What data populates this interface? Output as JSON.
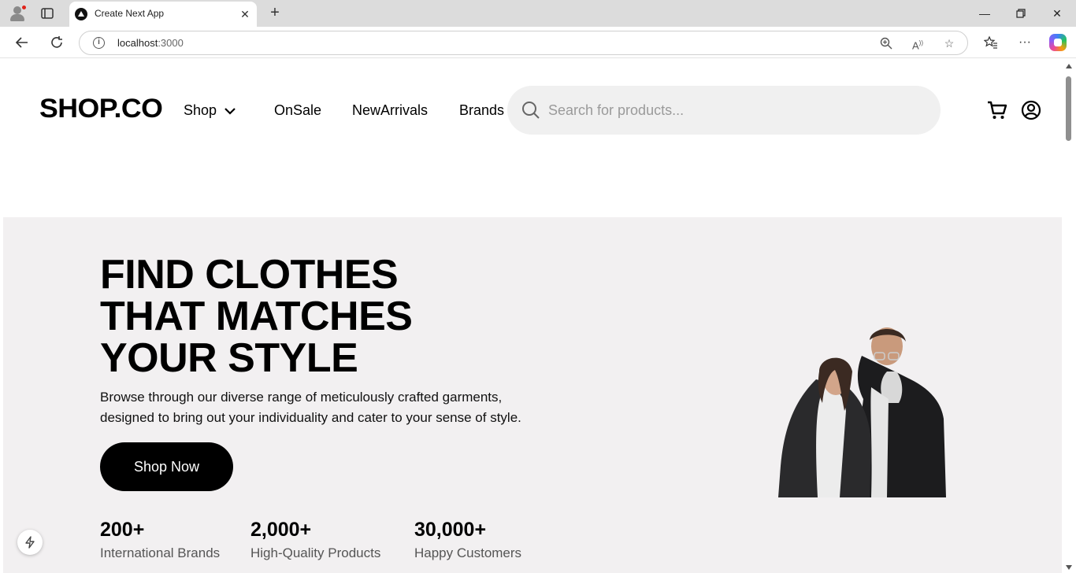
{
  "browser": {
    "tab_title": "Create Next App",
    "url_host": "localhost",
    "url_port": ":3000",
    "icons": {
      "profile": "profile-avatar-icon",
      "tab_actions": "tab-actions-icon",
      "close_tab": "close-icon",
      "new_tab": "plus-icon",
      "minimize": "minimize-icon",
      "restore": "restore-icon",
      "close_window": "close-icon",
      "back": "back-arrow-icon",
      "reload": "reload-icon",
      "site_info": "info-icon",
      "zoom": "zoom-icon",
      "read_aloud": "read-aloud-icon",
      "favorite": "star-icon",
      "favorites": "favorites-icon",
      "more": "more-icon",
      "copilot": "copilot-icon"
    }
  },
  "header": {
    "logo": "SHOP.CO",
    "nav": {
      "shop": "Shop",
      "on_sale": "OnSale",
      "new_arrivals": "NewArrivals",
      "brands": "Brands"
    },
    "search_placeholder": "Search for products..."
  },
  "hero": {
    "title_lines": [
      "FIND CLOTHES",
      "THAT MATCHES",
      "YOUR STYLE"
    ],
    "description_lines": [
      "Browse through our diverse range of meticulously crafted garments,",
      "designed to bring out your individuality and cater to your sense of style."
    ],
    "cta": "Shop Now",
    "stats": [
      {
        "value": "200+",
        "label": "International Brands"
      },
      {
        "value": "2,000+",
        "label": "High-Quality Products"
      },
      {
        "value": "30,000+",
        "label": "Happy Customers"
      }
    ]
  },
  "colors": {
    "hero_bg": "#f2f0f1",
    "search_bg": "#f0f0f0",
    "primary": "#000000"
  }
}
